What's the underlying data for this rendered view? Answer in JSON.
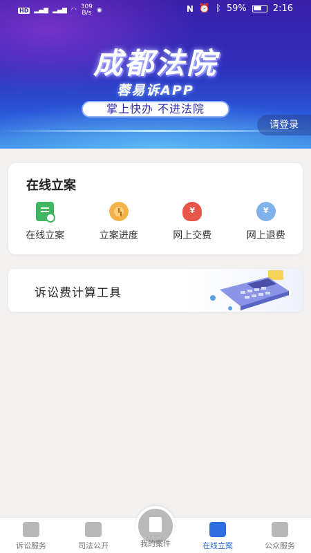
{
  "status_bar": {
    "left_badge": "HD",
    "network_speed": "309",
    "network_speed_unit": "B/s",
    "battery": "59%",
    "time": "2:16"
  },
  "banner": {
    "title": "成都法院",
    "subtitle": "蓉易诉APP",
    "slogan": "掌上快办  不进法院",
    "login_label": "请登录"
  },
  "case_card": {
    "title": "在线立案",
    "items": [
      {
        "label": "在线立案",
        "icon": "file-check-icon"
      },
      {
        "label": "立案进度",
        "icon": "clock-icon"
      },
      {
        "label": "网上交费",
        "icon": "yuan-hand-icon",
        "glyph": "¥"
      },
      {
        "label": "网上退费",
        "icon": "yuan-refund-icon",
        "glyph": "¥"
      }
    ]
  },
  "calculator": {
    "title": "诉讼费计算工具"
  },
  "bottom_nav": {
    "items": [
      {
        "label": "诉讼服务"
      },
      {
        "label": "司法公开"
      },
      {
        "label": "我的案件"
      },
      {
        "label": "在线立案"
      },
      {
        "label": "公众服务"
      }
    ],
    "active_index": 3,
    "active_color": "#2d6fe0"
  }
}
